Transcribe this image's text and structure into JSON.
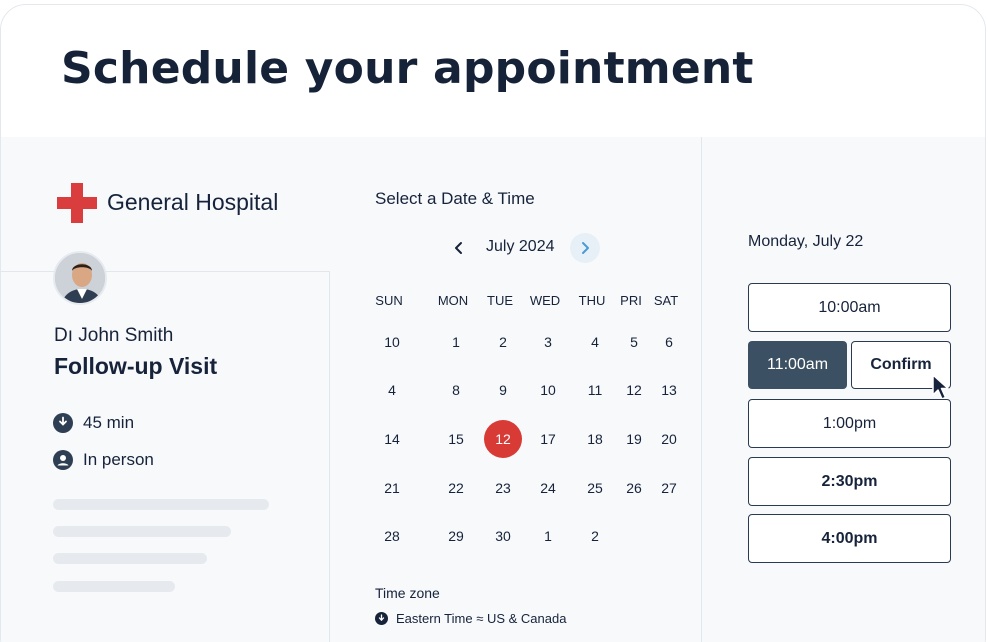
{
  "header": {
    "title": "Schedule your appointment"
  },
  "provider": {
    "hospital_name": "General Hospital",
    "doctor_name": "Dı John Smith",
    "visit_type": "Follow-up Visit",
    "duration": "45 min",
    "location": "In person"
  },
  "calendar": {
    "section_title": "Select a Date & Time",
    "month_label": "July 2024",
    "weekdays": [
      "SUN",
      "MON",
      "TUE",
      "WED",
      "THU",
      "PRI",
      "SAT"
    ],
    "weeks": [
      [
        "10",
        "1",
        "2",
        "3",
        "4",
        "5",
        "6"
      ],
      [
        "4",
        "8",
        "9",
        "10",
        "11",
        "12",
        "13"
      ],
      [
        "14",
        "15",
        "12",
        "17",
        "18",
        "19",
        "20"
      ],
      [
        "21",
        "22",
        "23",
        "24",
        "25",
        "26",
        "27"
      ],
      [
        "28",
        "29",
        "30",
        "1",
        "2",
        "",
        ""
      ]
    ],
    "selected_day": "12",
    "timezone_title": "Time zone",
    "timezone_value": "Eastern Time ≈ US & Canada"
  },
  "times": {
    "selected_date": "Monday, July 22",
    "slots": [
      "10:00am",
      "11:00am",
      "1:00pm",
      "2:30pm",
      "4:00pm"
    ],
    "selected_slot": "11:00am",
    "confirm_label": "Confirm"
  },
  "colors": {
    "accent_red": "#d83a36",
    "selected_slot_bg": "#3c5063",
    "title_text": "#152238"
  },
  "icons": {
    "logo": "red-cross-icon",
    "duration": "clock-icon",
    "location": "person-icon",
    "prev": "chevron-left-icon",
    "next": "chevron-right-icon",
    "timezone": "globe-icon",
    "cursor": "mouse-pointer-icon"
  }
}
